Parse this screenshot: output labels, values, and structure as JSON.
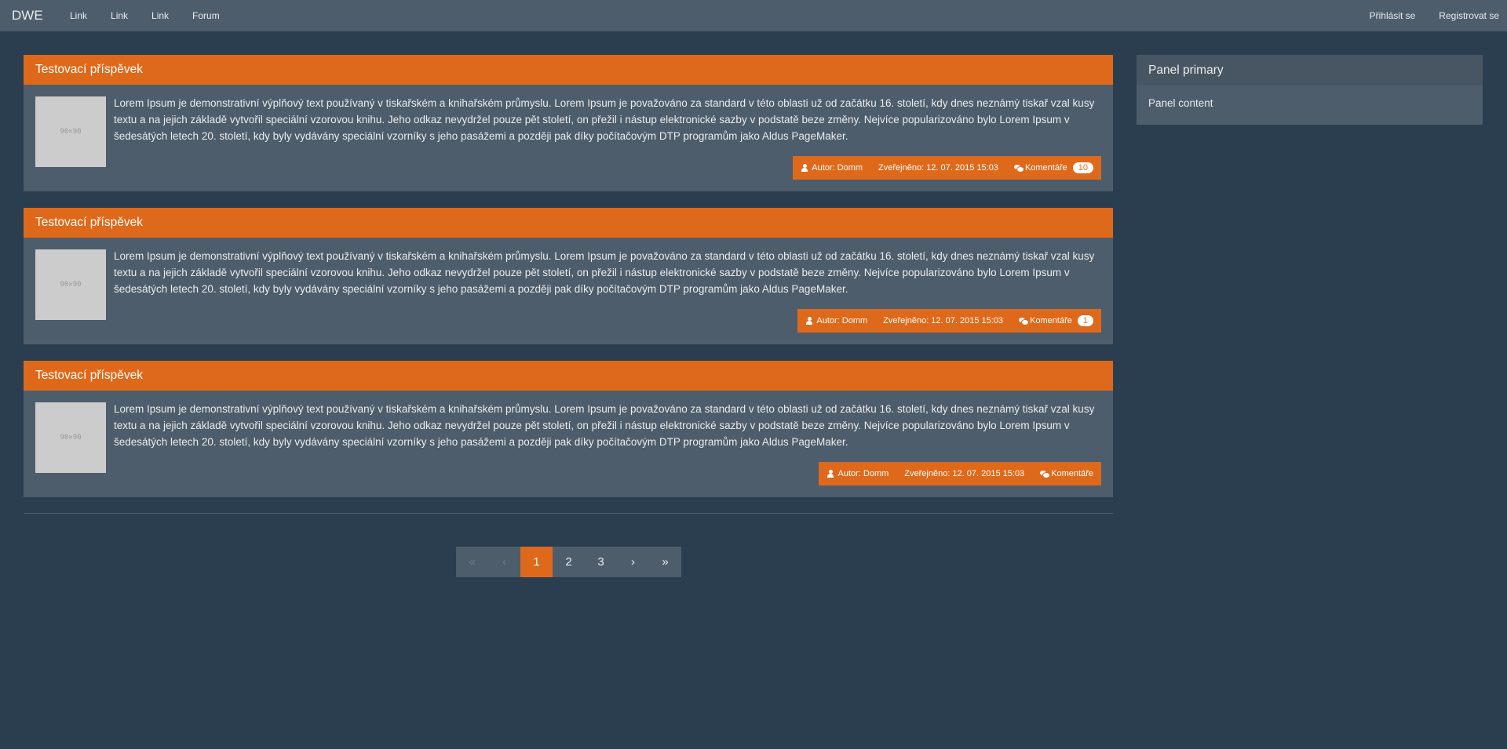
{
  "navbar": {
    "brand": "DWE",
    "links": [
      "Link",
      "Link",
      "Link",
      "Forum"
    ],
    "right_links": [
      "Přihlásit se",
      "Registrovat se"
    ]
  },
  "posts": [
    {
      "title": "Testovací příspěvek",
      "thumb_label": "90×90",
      "text": "Lorem Ipsum je demonstrativní výplňový text používaný v tiskařském a knihařském průmyslu. Lorem Ipsum je považováno za standard v této oblasti už od začátku 16. století, kdy dnes neznámý tiskař vzal kusy textu a na jejich základě vytvořil speciální vzorovou knihu. Jeho odkaz nevydržel pouze pět století, on přežil i nástup elektronické sazby v podstatě beze změny. Nejvíce popularizováno bylo Lorem Ipsum v šedesátých letech 20. století, kdy byly vydávány speciální vzorníky s jeho pasážemi a později pak díky počítačovým DTP programům jako Aldus PageMaker.",
      "author": "Autor: Domm",
      "date": "Zveřejněno: 12. 07. 2015 15:03",
      "comments_label": "Komentáře",
      "comments_count": "10"
    },
    {
      "title": "Testovací příspěvek",
      "thumb_label": "90×90",
      "text": "Lorem Ipsum je demonstrativní výplňový text používaný v tiskařském a knihařském průmyslu. Lorem Ipsum je považováno za standard v této oblasti už od začátku 16. století, kdy dnes neznámý tiskař vzal kusy textu a na jejich základě vytvořil speciální vzorovou knihu. Jeho odkaz nevydržel pouze pět století, on přežil i nástup elektronické sazby v podstatě beze změny. Nejvíce popularizováno bylo Lorem Ipsum v šedesátých letech 20. století, kdy byly vydávány speciální vzorníky s jeho pasážemi a později pak díky počítačovým DTP programům jako Aldus PageMaker.",
      "author": "Autor: Domm",
      "date": "Zveřejněno: 12. 07. 2015 15:03",
      "comments_label": "Komentáře",
      "comments_count": "1"
    },
    {
      "title": "Testovací příspěvek",
      "thumb_label": "90×90",
      "text": "Lorem Ipsum je demonstrativní výplňový text používaný v tiskařském a knihařském průmyslu. Lorem Ipsum je považováno za standard v této oblasti už od začátku 16. století, kdy dnes neznámý tiskař vzal kusy textu a na jejich základě vytvořil speciální vzorovou knihu. Jeho odkaz nevydržel pouze pět století, on přežil i nástup elektronické sazby v podstatě beze změny. Nejvíce popularizováno bylo Lorem Ipsum v šedesátých letech 20. století, kdy byly vydávány speciální vzorníky s jeho pasážemi a později pak díky počítačovým DTP programům jako Aldus PageMaker.",
      "author": "Autor: Domm",
      "date": "Zveřejněno: 12. 07. 2015 15:03",
      "comments_label": "Komentáře",
      "comments_count": ""
    }
  ],
  "pagination": {
    "first": "«",
    "prev": "‹",
    "pages": [
      "1",
      "2",
      "3"
    ],
    "active_page": "1",
    "next": "›",
    "last": "»"
  },
  "panel": {
    "title": "Panel primary",
    "content": "Panel content"
  },
  "colors": {
    "background": "#2b3e50",
    "navbar": "#4e5d6c",
    "accent": "#df691a",
    "panel": "#4e5d6c"
  },
  "icons": {
    "author": "user-icon",
    "comments": "comment-icon"
  }
}
